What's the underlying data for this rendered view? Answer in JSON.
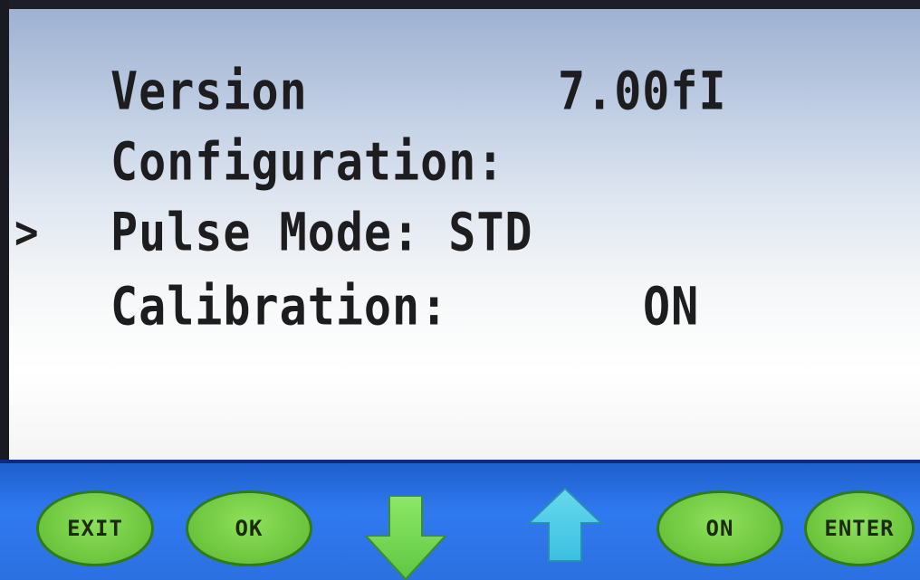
{
  "display": {
    "version_label": "Version",
    "version_value": "7.00fI",
    "configuration_label": "Configuration:",
    "pulse_mode_text": "Pulse Mode: STD",
    "calibration_label": "Calibration:",
    "calibration_value": "ON",
    "cursor": ">"
  },
  "buttons": {
    "exit_label": "EXIT",
    "ok_label": "OK",
    "down_icon": "arrow-down",
    "up_icon": "arrow-up",
    "on_label": "ON",
    "enter_label": "ENTER"
  },
  "colors": {
    "button_green": "#6cc43d",
    "button_bar_blue": "#2f79ef",
    "text": "#1d1d1f"
  }
}
